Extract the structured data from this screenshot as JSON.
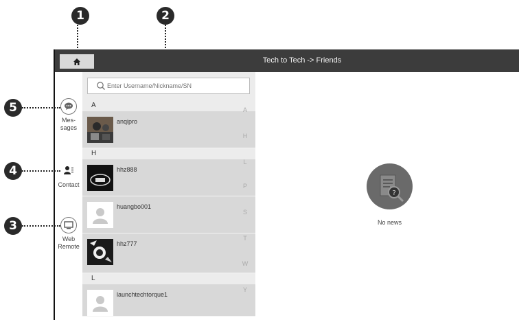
{
  "callouts": {
    "c1": "1",
    "c2": "2",
    "c3": "3",
    "c4": "4",
    "c5": "5"
  },
  "header": {
    "title": "Tech to Tech -> Friends",
    "home_icon": "home-icon"
  },
  "nav": {
    "messages_label": "Mes-\nsages",
    "contact_label": "Contact",
    "remote_label": "Web\nRemote"
  },
  "search": {
    "placeholder": "Enter Username/Nickname/SN"
  },
  "groups": {
    "a": {
      "letter": "A",
      "users": [
        "anqipro"
      ]
    },
    "h": {
      "letter": "H",
      "users": [
        "hhz888",
        "huangbo001",
        "hhz777"
      ]
    },
    "l": {
      "letter": "L",
      "users": [
        "launchtechtorque1"
      ]
    }
  },
  "index_letters": [
    "A",
    "H",
    "L",
    "P",
    "S",
    "T",
    "W",
    "Y"
  ],
  "empty_state": {
    "text": "No news"
  }
}
